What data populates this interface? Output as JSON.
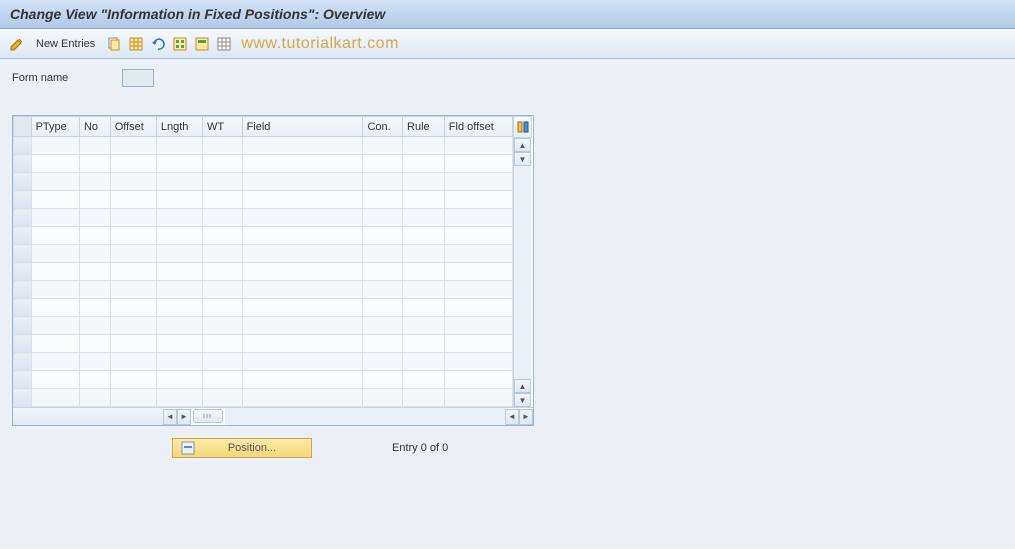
{
  "titlebar": {
    "title": "Change View \"Information in Fixed Positions\": Overview"
  },
  "toolbar": {
    "new_entries_label": "New Entries",
    "watermark": "www.tutorialkart.com",
    "icons": {
      "toggle": "toggle-icon",
      "copy": "copy-icon",
      "delete": "delete-icon",
      "undo": "undo-icon",
      "select_all": "select-all-icon",
      "select_block": "select-block-icon",
      "deselect_all": "deselect-all-icon"
    }
  },
  "form": {
    "form_name_label": "Form name",
    "form_name_value": ""
  },
  "table": {
    "columns": {
      "ptype": "PType",
      "no": "No",
      "offset": "Offset",
      "lngth": "Lngth",
      "wt": "WT",
      "field": "Field",
      "con": "Con.",
      "rule": "Rule",
      "fldoffset": "Fld offset"
    },
    "rows": [
      {
        "ptype": "",
        "no": "",
        "offset": "",
        "lngth": "",
        "wt": "",
        "field": "",
        "con": "",
        "rule": "",
        "fldoffset": ""
      },
      {
        "ptype": "",
        "no": "",
        "offset": "",
        "lngth": "",
        "wt": "",
        "field": "",
        "con": "",
        "rule": "",
        "fldoffset": ""
      },
      {
        "ptype": "",
        "no": "",
        "offset": "",
        "lngth": "",
        "wt": "",
        "field": "",
        "con": "",
        "rule": "",
        "fldoffset": ""
      },
      {
        "ptype": "",
        "no": "",
        "offset": "",
        "lngth": "",
        "wt": "",
        "field": "",
        "con": "",
        "rule": "",
        "fldoffset": ""
      },
      {
        "ptype": "",
        "no": "",
        "offset": "",
        "lngth": "",
        "wt": "",
        "field": "",
        "con": "",
        "rule": "",
        "fldoffset": ""
      },
      {
        "ptype": "",
        "no": "",
        "offset": "",
        "lngth": "",
        "wt": "",
        "field": "",
        "con": "",
        "rule": "",
        "fldoffset": ""
      },
      {
        "ptype": "",
        "no": "",
        "offset": "",
        "lngth": "",
        "wt": "",
        "field": "",
        "con": "",
        "rule": "",
        "fldoffset": ""
      },
      {
        "ptype": "",
        "no": "",
        "offset": "",
        "lngth": "",
        "wt": "",
        "field": "",
        "con": "",
        "rule": "",
        "fldoffset": ""
      },
      {
        "ptype": "",
        "no": "",
        "offset": "",
        "lngth": "",
        "wt": "",
        "field": "",
        "con": "",
        "rule": "",
        "fldoffset": ""
      },
      {
        "ptype": "",
        "no": "",
        "offset": "",
        "lngth": "",
        "wt": "",
        "field": "",
        "con": "",
        "rule": "",
        "fldoffset": ""
      },
      {
        "ptype": "",
        "no": "",
        "offset": "",
        "lngth": "",
        "wt": "",
        "field": "",
        "con": "",
        "rule": "",
        "fldoffset": ""
      },
      {
        "ptype": "",
        "no": "",
        "offset": "",
        "lngth": "",
        "wt": "",
        "field": "",
        "con": "",
        "rule": "",
        "fldoffset": ""
      },
      {
        "ptype": "",
        "no": "",
        "offset": "",
        "lngth": "",
        "wt": "",
        "field": "",
        "con": "",
        "rule": "",
        "fldoffset": ""
      },
      {
        "ptype": "",
        "no": "",
        "offset": "",
        "lngth": "",
        "wt": "",
        "field": "",
        "con": "",
        "rule": "",
        "fldoffset": ""
      },
      {
        "ptype": "",
        "no": "",
        "offset": "",
        "lngth": "",
        "wt": "",
        "field": "",
        "con": "",
        "rule": "",
        "fldoffset": ""
      }
    ]
  },
  "footer": {
    "position_label": "Position...",
    "entry_text": "Entry 0 of 0"
  }
}
